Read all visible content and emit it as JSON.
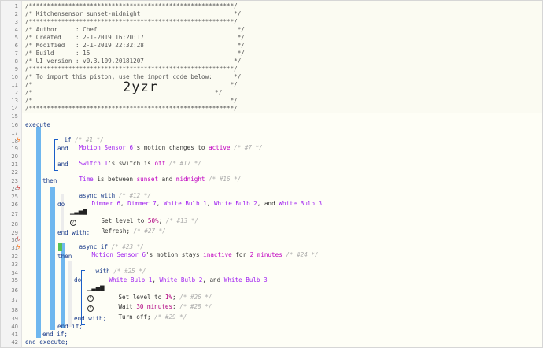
{
  "header": {
    "border": "/*********************************************************/",
    "title": "/* Kitchensensor sunset-midnight                          */",
    "author": "/* Author     : Chef                                       */",
    "created": "/* Created    : 2-1-2019 16:20:17                          */",
    "modified": "/* Modified   : 2-1-2019 22:32:28                          */",
    "build": "/* Build      : 15                                         */",
    "ui_version": "/* UI version : v0.3.109.20181207                         */",
    "import_note": "/* To import this piston, use the import code below:      */",
    "blank": "/*                                                       */",
    "blank_right": "*/",
    "code_prefix": "/*",
    "import_code": "2yzr"
  },
  "code": {
    "execute": "execute",
    "if_kw": "if",
    "cmt_1": "/* #1 */",
    "motion_sensor_6": "Motion Sensor 6",
    "motion_text": "'s motion changes to",
    "active": "active",
    "cmt_7": "/* #7 */",
    "and": "and",
    "switch_1": "Switch 1",
    "switch_text": "'s switch is",
    "off": "off",
    "cmt_17": "/* #17 */",
    "time": "Time",
    "time_text": "is between",
    "sunset": "sunset",
    "and2": "and",
    "midnight": "midnight",
    "cmt_16": "/* #16 */",
    "then": "then",
    "async_with": "async with",
    "cmt_12": "/* #12 */",
    "dimmer_6": "Dimmer 6",
    "comma": ",",
    "dimmer_7": "Dimmer 7",
    "white_bulb_1": "White Bulb 1",
    "white_bulb_2": "White Bulb 2",
    "and_word": ", and",
    "white_bulb_3": "White Bulb 3",
    "do": "do",
    "set_level": "Set level to",
    "level_50": "50%",
    "semicolon": ";",
    "cmt_13": "/* #13 */",
    "refresh": "Refresh;",
    "cmt_27": "/* #27 */",
    "end_with": "end with;",
    "async_if": "async if",
    "cmt_23": "/* #23 */",
    "stays_text": "'s motion stays",
    "inactive": "inactive",
    "for_text": "for",
    "two_minutes": "2 minutes",
    "cmt_24": "/* #24 */",
    "with": "with",
    "cmt_25": "/* #25 */",
    "level_1": "1%",
    "cmt_26": "/* #26 */",
    "wait": "Wait",
    "thirty_minutes": "30 minutes",
    "cmt_28": "/* #28 */",
    "turn_off": "Turn off;",
    "cmt_29": "/* #29 */",
    "end_with2": "end with;",
    "end_if": "end if;",
    "end_if2": "end if;",
    "end_execute": "end execute;"
  },
  "line_numbers": [
    "1",
    "2",
    "3",
    "4",
    "5",
    "6",
    "7",
    "8",
    "9",
    "10",
    "11",
    "12",
    "13",
    "14",
    "15",
    "16",
    "17",
    "18",
    "19",
    "20",
    "21",
    "22",
    "23",
    "24",
    "25",
    "26",
    "27",
    "28",
    "29",
    "30",
    "31",
    "32",
    "33",
    "34",
    "35",
    "36",
    "37",
    "38",
    "39",
    "40",
    "41",
    "42"
  ],
  "icons": {
    "bolt": "ϟ",
    "signal": "▁▃▅▇",
    "question": "?"
  },
  "colors": {
    "device": "#a020f0",
    "value": "#c000c0",
    "keyword": "#1a3b8a",
    "comment": "#aaaaaa",
    "trigger": "#ff6600",
    "bar_blue": "#6fb7ef",
    "bar_green": "#55c255"
  }
}
